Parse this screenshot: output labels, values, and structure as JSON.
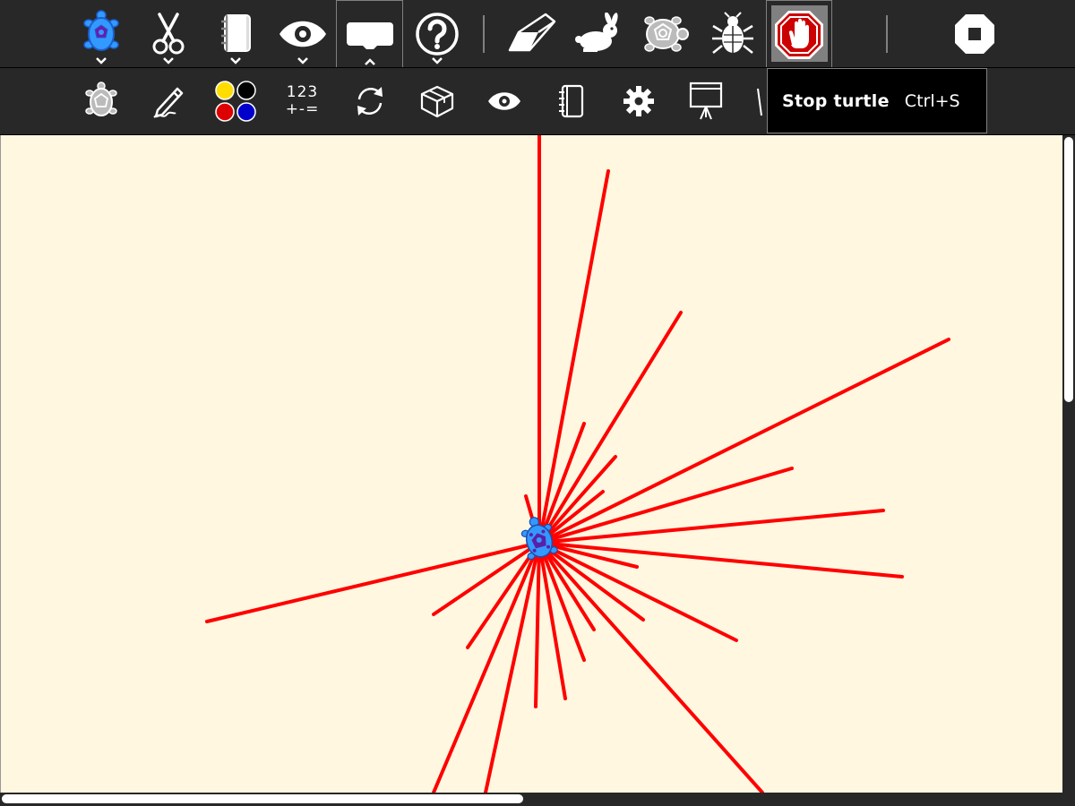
{
  "main_toolbar": {
    "items": [
      {
        "icon": "turtle-activity-icon",
        "has_menu": true
      },
      {
        "icon": "scissors-icon",
        "has_menu": true
      },
      {
        "icon": "journal-notebook-icon",
        "has_menu": true
      },
      {
        "icon": "eye-icon",
        "has_menu": true
      },
      {
        "icon": "palette-toggle-icon",
        "has_menu": true,
        "active": true
      },
      {
        "icon": "help-icon",
        "has_menu": true
      },
      {
        "icon": "eraser-icon"
      },
      {
        "icon": "rabbit-run-fast-icon"
      },
      {
        "icon": "turtle-run-slow-icon"
      },
      {
        "icon": "bug-debug-icon"
      },
      {
        "icon": "stop-hand-icon",
        "pressed": true
      },
      {
        "icon": "stop-activity-icon"
      }
    ]
  },
  "sub_toolbar": {
    "numbers_label_line1": "123",
    "numbers_label_line2": "+-="
  },
  "tooltip": {
    "label": "Stop turtle",
    "shortcut": "Ctrl+S"
  },
  "colors": {
    "toolbar_bg": "#282828",
    "canvas_bg": "#fff7e0",
    "pen": "#ff0000",
    "turtle": "#3399ff",
    "stop_red": "#cc0000"
  }
}
